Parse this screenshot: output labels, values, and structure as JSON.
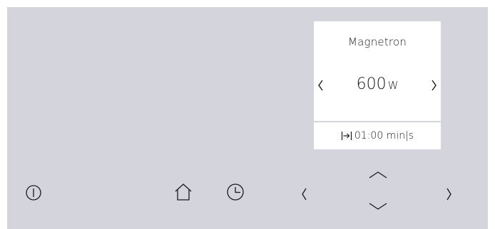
{
  "mode": {
    "title": "Magnetron",
    "power_value": "600",
    "power_unit": "W"
  },
  "duration": {
    "text": "01:00 min|s"
  },
  "controls": {
    "power_icon": "power-icon",
    "home_icon": "home-icon",
    "clock_icon": "clock-icon",
    "left_icon": "chevron-left-icon",
    "up_icon": "chevron-up-icon",
    "down_icon": "chevron-down-icon",
    "right_icon": "chevron-right-icon"
  },
  "colors": {
    "background": "#d3d4dc",
    "card": "#ffffff",
    "ink": "#1a1a1a"
  }
}
